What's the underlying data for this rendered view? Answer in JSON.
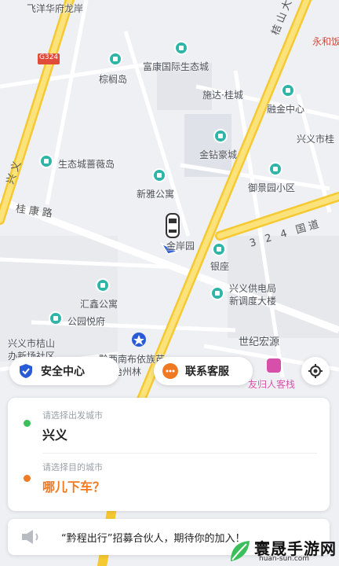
{
  "map": {
    "labels": {
      "feiyang": "飞洋华府龙岸",
      "g324": "G324",
      "guishan_ave": "桔山大道",
      "yonghe": "永和饭",
      "luhu": "棕榈岛",
      "fukang": "富康国际生态城",
      "shida": "施达·桂城",
      "ronghui": "融金中心",
      "xingyi_gui": "兴义市桂",
      "shengtai": "生态城蔷薇岛",
      "jinzuan": "金钻豪城",
      "yujing": "御景园小区",
      "xinya": "新雅公寓",
      "guikang": "桂康路",
      "xingyi_left": "兴义",
      "road324": "3 2 4 国道",
      "yinyuan": "银座",
      "xingyi_power": "兴义供电局",
      "xintiao": "新调度大楼",
      "huixin": "汇鑫公寓",
      "gongyuan": "公园悦府",
      "jinyuan": "金岸园",
      "century": "世纪宏源",
      "qiansouth": "黔西南布依族苗",
      "autonomy": "自治州林",
      "xingyi_city": "兴义市桔山",
      "shequ": "办新场社区",
      "hotel": "友归人客栈"
    }
  },
  "actions": {
    "safety": "安全中心",
    "service": "联系客服"
  },
  "route": {
    "origin_hint": "请选择出发城市",
    "origin_value": "兴义",
    "dest_hint": "请选择目的城市",
    "dest_value": "哪儿下车？"
  },
  "notice": {
    "text": "“黔程出行”招募合伙人，期待你的加入！"
  },
  "watermark": {
    "title": "寰晟手游网",
    "sub": "huan-sun.com"
  },
  "colors": {
    "road_main": "#f7d23c",
    "accent_green": "#3bbf5a",
    "accent_orange": "#f07a24",
    "poi": "#2fb5a8",
    "brand_blue": "#2a5bd7"
  }
}
